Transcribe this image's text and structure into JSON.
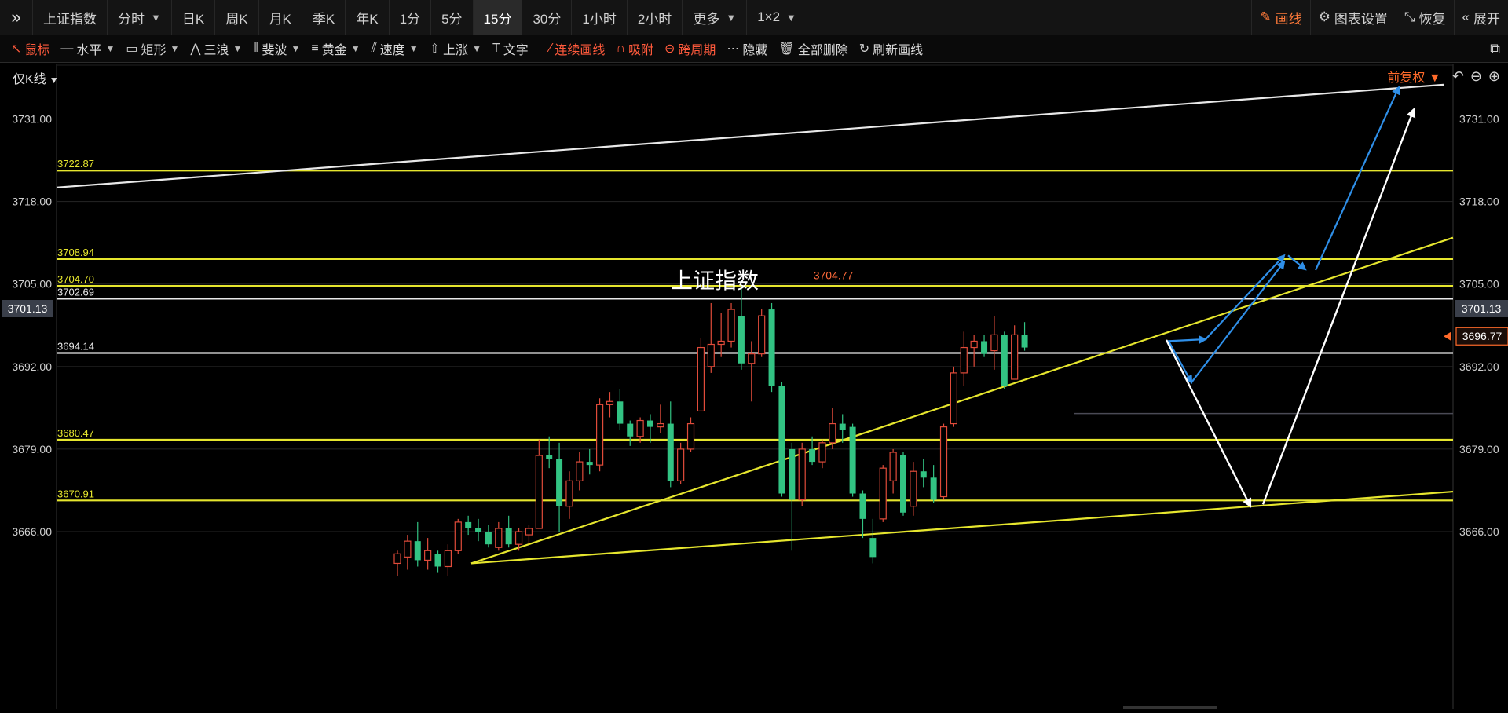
{
  "topbar": {
    "tabs": [
      "上证指数",
      "分时",
      "日K",
      "周K",
      "月K",
      "季K",
      "年K",
      "1分",
      "5分",
      "15分",
      "30分",
      "1小时",
      "2小时",
      "更多",
      "1×2"
    ],
    "active_tab": "15分",
    "right": {
      "draw": "画线",
      "settings": "图表设置",
      "restore": "恢复",
      "expand": "展开"
    }
  },
  "drawbar": {
    "tools": [
      "鼠标",
      "水平",
      "矩形",
      "三浪",
      "斐波",
      "黄金",
      "速度",
      "上涨",
      "文字"
    ],
    "actions": [
      "连续画线",
      "吸附",
      "跨周期",
      "隐藏",
      "全部删除",
      "刷新画线"
    ]
  },
  "chart_header": {
    "kline_toggle": "仅K线",
    "rights": "前复权"
  },
  "colors": {
    "up": "#e04b3a",
    "down": "#32c383",
    "fib": "#e6e62e",
    "hline": "#e8e8e8",
    "blue_arrow": "#2f8fe8",
    "accent": "#ff6a2a"
  },
  "chart_data": {
    "type": "candlestick",
    "title": "上证指数",
    "timeframe": "15分",
    "ylim": [
      3660.0,
      3741.0
    ],
    "yticks": [
      "3731.00",
      "3718.00",
      "3705.00",
      "3692.00",
      "3679.00",
      "3666.00"
    ],
    "current_price": "3696.77",
    "crosshair_price": "3701.13",
    "high_label": "3704.77",
    "horizontal_levels": [
      {
        "value": 3722.87,
        "label": "3722.87",
        "color": "yellow"
      },
      {
        "value": 3708.94,
        "label": "3708.94",
        "color": "yellow"
      },
      {
        "value": 3704.7,
        "label": "3704.70",
        "color": "yellow"
      },
      {
        "value": 3702.69,
        "label": "3702.69",
        "color": "white"
      },
      {
        "value": 3694.14,
        "label": "3694.14",
        "color": "white"
      },
      {
        "value": 3680.47,
        "label": "3680.47",
        "color": "yellow"
      },
      {
        "value": 3670.91,
        "label": "3670.91",
        "color": "yellow"
      }
    ],
    "candles": [
      {
        "o": 3661.0,
        "h": 3663.0,
        "l": 3659.0,
        "c": 3662.5
      },
      {
        "o": 3662.0,
        "h": 3665.5,
        "l": 3660.0,
        "c": 3664.5
      },
      {
        "o": 3664.5,
        "h": 3667.5,
        "l": 3660.5,
        "c": 3661.5
      },
      {
        "o": 3661.5,
        "h": 3665.0,
        "l": 3660.0,
        "c": 3663.0
      },
      {
        "o": 3662.5,
        "h": 3663.0,
        "l": 3659.5,
        "c": 3660.5
      },
      {
        "o": 3660.5,
        "h": 3664.0,
        "l": 3659.0,
        "c": 3663.0
      },
      {
        "o": 3663.0,
        "h": 3668.0,
        "l": 3662.5,
        "c": 3667.5
      },
      {
        "o": 3667.5,
        "h": 3668.5,
        "l": 3665.5,
        "c": 3666.5
      },
      {
        "o": 3666.5,
        "h": 3668.0,
        "l": 3664.5,
        "c": 3666.0
      },
      {
        "o": 3666.0,
        "h": 3667.0,
        "l": 3663.5,
        "c": 3664.0
      },
      {
        "o": 3663.5,
        "h": 3667.5,
        "l": 3663.0,
        "c": 3666.5
      },
      {
        "o": 3666.5,
        "h": 3668.5,
        "l": 3663.5,
        "c": 3664.0
      },
      {
        "o": 3664.0,
        "h": 3666.5,
        "l": 3663.0,
        "c": 3666.0
      },
      {
        "o": 3665.5,
        "h": 3667.0,
        "l": 3664.0,
        "c": 3666.5
      },
      {
        "o": 3666.5,
        "h": 3680.5,
        "l": 3668.5,
        "c": 3678.0
      },
      {
        "o": 3678.0,
        "h": 3681.0,
        "l": 3676.0,
        "c": 3677.5
      },
      {
        "o": 3677.5,
        "h": 3680.0,
        "l": 3666.0,
        "c": 3670.0
      },
      {
        "o": 3670.0,
        "h": 3675.5,
        "l": 3668.0,
        "c": 3674.0
      },
      {
        "o": 3674.0,
        "h": 3678.5,
        "l": 3672.5,
        "c": 3677.0
      },
      {
        "o": 3677.0,
        "h": 3679.0,
        "l": 3675.0,
        "c": 3676.5
      },
      {
        "o": 3676.5,
        "h": 3687.0,
        "l": 3675.5,
        "c": 3686.0
      },
      {
        "o": 3686.0,
        "h": 3688.0,
        "l": 3684.0,
        "c": 3686.5
      },
      {
        "o": 3686.5,
        "h": 3688.5,
        "l": 3682.0,
        "c": 3683.0
      },
      {
        "o": 3683.0,
        "h": 3683.5,
        "l": 3679.5,
        "c": 3681.0
      },
      {
        "o": 3681.0,
        "h": 3684.0,
        "l": 3680.0,
        "c": 3683.5
      },
      {
        "o": 3683.5,
        "h": 3684.5,
        "l": 3680.0,
        "c": 3682.5
      },
      {
        "o": 3682.5,
        "h": 3686.0,
        "l": 3681.5,
        "c": 3683.0
      },
      {
        "o": 3683.0,
        "h": 3686.5,
        "l": 3673.0,
        "c": 3674.0
      },
      {
        "o": 3674.0,
        "h": 3680.0,
        "l": 3673.5,
        "c": 3679.0
      },
      {
        "o": 3679.0,
        "h": 3684.0,
        "l": 3678.5,
        "c": 3683.0
      },
      {
        "o": 3685.0,
        "h": 3696.5,
        "l": 3685.0,
        "c": 3695.0
      },
      {
        "o": 3692.0,
        "h": 3702.0,
        "l": 3691.0,
        "c": 3695.5
      },
      {
        "o": 3695.5,
        "h": 3700.5,
        "l": 3693.5,
        "c": 3696.0
      },
      {
        "o": 3696.0,
        "h": 3702.0,
        "l": 3695.0,
        "c": 3701.0
      },
      {
        "o": 3700.0,
        "h": 3704.77,
        "l": 3691.5,
        "c": 3692.5
      },
      {
        "o": 3692.5,
        "h": 3696.0,
        "l": 3686.5,
        "c": 3694.0
      },
      {
        "o": 3694.0,
        "h": 3701.0,
        "l": 3693.5,
        "c": 3700.0
      },
      {
        "o": 3701.0,
        "h": 3702.0,
        "l": 3688.0,
        "c": 3689.0
      },
      {
        "o": 3689.0,
        "h": 3689.5,
        "l": 3671.5,
        "c": 3672.0
      },
      {
        "o": 3679.0,
        "h": 3680.0,
        "l": 3663.0,
        "c": 3671.0
      },
      {
        "o": 3671.0,
        "h": 3680.0,
        "l": 3670.0,
        "c": 3679.0
      },
      {
        "o": 3679.0,
        "h": 3681.0,
        "l": 3676.5,
        "c": 3677.0
      },
      {
        "o": 3677.0,
        "h": 3680.5,
        "l": 3676.0,
        "c": 3680.0
      },
      {
        "o": 3680.0,
        "h": 3685.5,
        "l": 3679.0,
        "c": 3683.0
      },
      {
        "o": 3683.0,
        "h": 3684.5,
        "l": 3680.0,
        "c": 3682.0
      },
      {
        "o": 3682.5,
        "h": 3683.0,
        "l": 3671.5,
        "c": 3672.0
      },
      {
        "o": 3672.0,
        "h": 3672.5,
        "l": 3665.0,
        "c": 3668.0
      },
      {
        "o": 3665.0,
        "h": 3668.0,
        "l": 3661.0,
        "c": 3662.0
      },
      {
        "o": 3668.0,
        "h": 3676.5,
        "l": 3667.5,
        "c": 3676.0
      },
      {
        "o": 3674.0,
        "h": 3679.0,
        "l": 3672.0,
        "c": 3678.5
      },
      {
        "o": 3678.0,
        "h": 3678.5,
        "l": 3668.5,
        "c": 3669.0
      },
      {
        "o": 3670.0,
        "h": 3677.0,
        "l": 3668.5,
        "c": 3675.5
      },
      {
        "o": 3675.5,
        "h": 3677.5,
        "l": 3673.0,
        "c": 3674.5
      },
      {
        "o": 3674.5,
        "h": 3676.5,
        "l": 3670.5,
        "c": 3671.0
      },
      {
        "o": 3671.5,
        "h": 3683.0,
        "l": 3671.0,
        "c": 3682.5
      },
      {
        "o": 3683.0,
        "h": 3692.0,
        "l": 3682.5,
        "c": 3691.0
      },
      {
        "o": 3691.0,
        "h": 3697.5,
        "l": 3689.0,
        "c": 3695.0
      },
      {
        "o": 3695.0,
        "h": 3697.0,
        "l": 3692.0,
        "c": 3696.0
      },
      {
        "o": 3696.0,
        "h": 3697.0,
        "l": 3693.5,
        "c": 3694.0
      },
      {
        "o": 3694.5,
        "h": 3700.0,
        "l": 3691.5,
        "c": 3697.0
      },
      {
        "o": 3697.0,
        "h": 3697.5,
        "l": 3688.5,
        "c": 3689.0
      },
      {
        "o": 3690.0,
        "h": 3698.5,
        "l": 3690.0,
        "c": 3697.0
      },
      {
        "o": 3697.0,
        "h": 3699.0,
        "l": 3694.5,
        "c": 3695.0
      }
    ]
  }
}
